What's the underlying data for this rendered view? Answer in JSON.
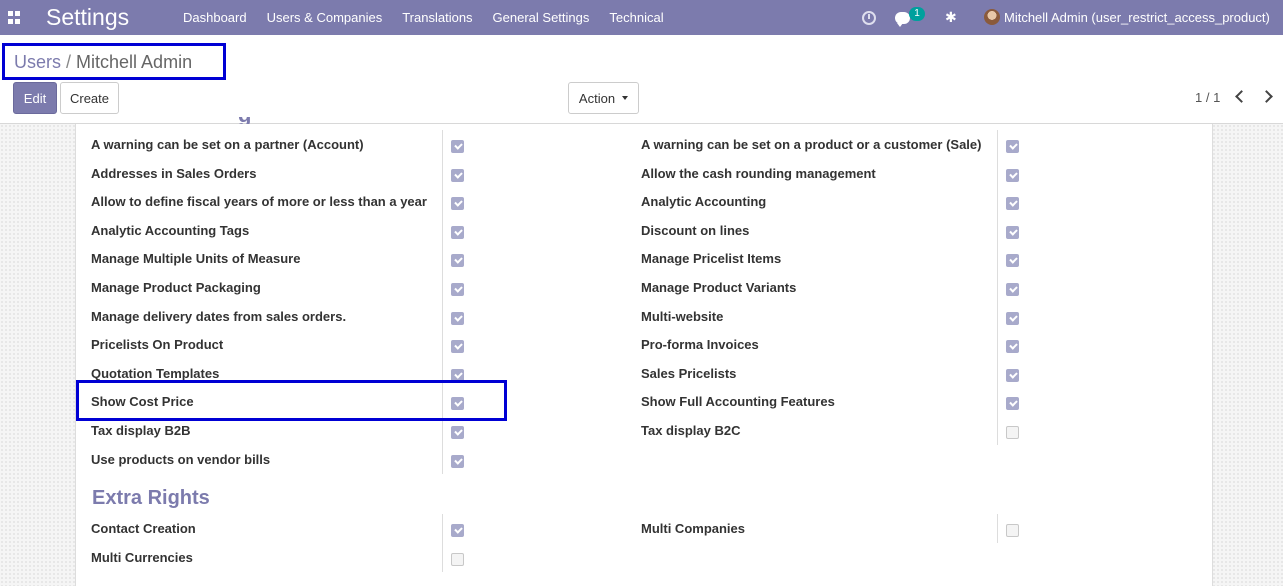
{
  "navbar": {
    "brand": "Settings",
    "menu": [
      "Dashboard",
      "Users & Companies",
      "Translations",
      "General Settings",
      "Technical"
    ],
    "chat_badge": "1",
    "user": "Mitchell Admin (user_restrict_access_product)"
  },
  "breadcrumb": {
    "parent": "Users",
    "current": "Mitchell Admin"
  },
  "buttons": {
    "edit": "Edit",
    "create": "Create",
    "action": "Action"
  },
  "pager": "1 / 1",
  "settings_rows": [
    {
      "left": {
        "label": "A warning can be set on a partner (Account)",
        "checked": true
      },
      "right": {
        "label": "A warning can be set on a product or a customer (Sale)",
        "checked": true
      }
    },
    {
      "left": {
        "label": "Addresses in Sales Orders",
        "checked": true
      },
      "right": {
        "label": "Allow the cash rounding management",
        "checked": true
      }
    },
    {
      "left": {
        "label": "Allow to define fiscal years of more or less than a year",
        "checked": true
      },
      "right": {
        "label": "Analytic Accounting",
        "checked": true
      }
    },
    {
      "left": {
        "label": "Analytic Accounting Tags",
        "checked": true
      },
      "right": {
        "label": "Discount on lines",
        "checked": true
      }
    },
    {
      "left": {
        "label": "Manage Multiple Units of Measure",
        "checked": true
      },
      "right": {
        "label": "Manage Pricelist Items",
        "checked": true
      }
    },
    {
      "left": {
        "label": "Manage Product Packaging",
        "checked": true
      },
      "right": {
        "label": "Manage Product Variants",
        "checked": true
      }
    },
    {
      "left": {
        "label": "Manage delivery dates from sales orders.",
        "checked": true
      },
      "right": {
        "label": "Multi-website",
        "checked": true
      }
    },
    {
      "left": {
        "label": "Pricelists On Product",
        "checked": true
      },
      "right": {
        "label": "Pro-forma Invoices",
        "checked": true
      }
    },
    {
      "left": {
        "label": "Quotation Templates",
        "checked": true
      },
      "right": {
        "label": "Sales Pricelists",
        "checked": true
      }
    },
    {
      "left": {
        "label": "Show Cost Price",
        "checked": true
      },
      "right": {
        "label": "Show Full Accounting Features",
        "checked": true
      }
    },
    {
      "left": {
        "label": "Tax display B2B",
        "checked": true
      },
      "right": {
        "label": "Tax display B2C",
        "checked": false
      }
    },
    {
      "left": {
        "label": "Use products on vendor bills",
        "checked": true
      },
      "right": null
    }
  ],
  "extra_rights": {
    "title": "Extra Rights",
    "rows": [
      {
        "left": {
          "label": "Contact Creation",
          "checked": true
        },
        "right": {
          "label": "Multi Companies",
          "checked": false
        }
      },
      {
        "left": {
          "label": "Multi Currencies",
          "checked": false
        },
        "right": null
      }
    ]
  },
  "colors": {
    "brand": "#7c7bad",
    "highlight": "#0000d4"
  }
}
